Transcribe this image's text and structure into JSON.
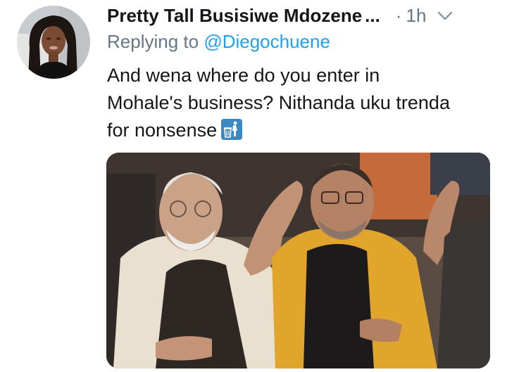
{
  "tweet": {
    "author": {
      "display_name": "Pretty Tall Busisiwe Mdozene",
      "name_truncation": "...",
      "avatar_icon": "profile-photo"
    },
    "timestamp": {
      "separator": "·",
      "relative_time": "1h"
    },
    "menu_icon": "chevron-down-icon",
    "reply": {
      "prefix": "Replying to",
      "handle": "@Diegochuene"
    },
    "text_lines": [
      "And wena where do you enter in",
      "Mohale's business? Nithanda uku trenda",
      "for nonsense"
    ],
    "emoji": "put-litter-in-its-place",
    "media": {
      "type": "photo"
    }
  },
  "colors": {
    "primary_text": "#14171a",
    "secondary_text": "#657786",
    "link": "#1da1f2",
    "emoji_blue": "#3b88c3"
  }
}
